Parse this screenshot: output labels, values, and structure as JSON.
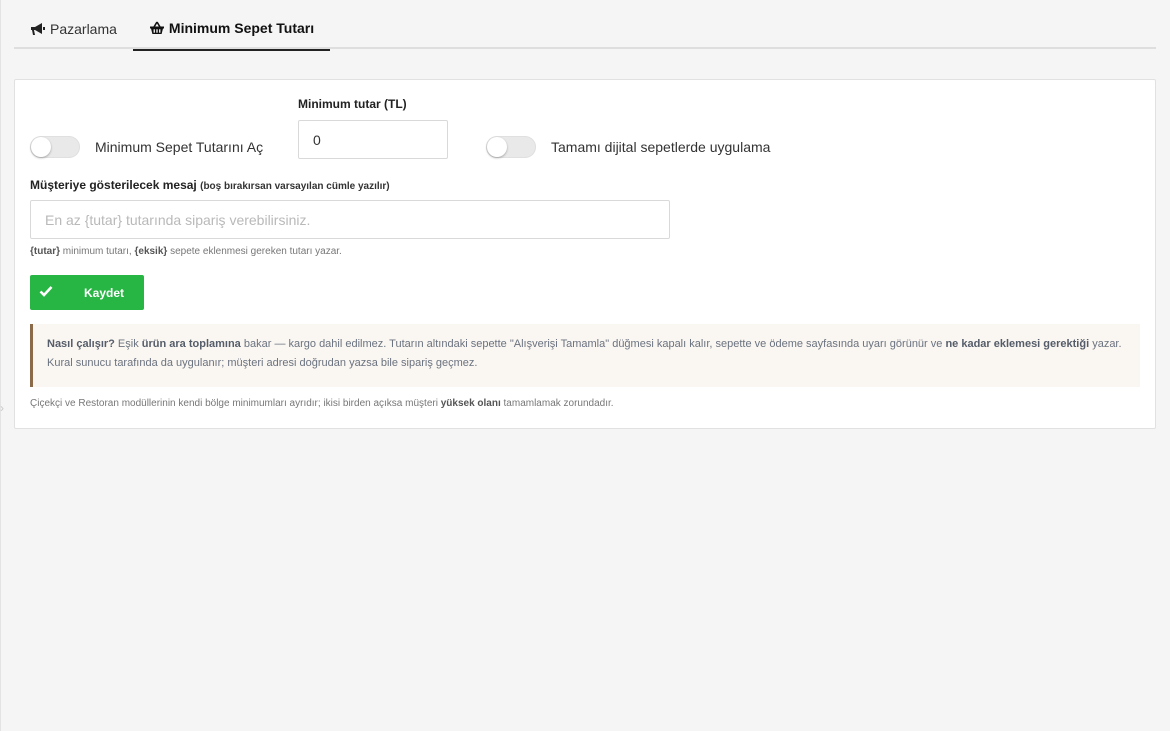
{
  "tabs": [
    {
      "label": "Pazarlama",
      "icon": "bullhorn-icon",
      "active": false
    },
    {
      "label": "Minimum Sepet Tutarı",
      "icon": "shopping-basket-icon",
      "active": true
    }
  ],
  "settings": {
    "enable_toggle": {
      "label": "Minimum Sepet Tutarını Aç",
      "on": false
    },
    "min_amount": {
      "label": "Minimum tutar (TL)",
      "value": "0"
    },
    "digital_toggle": {
      "label": "Tamamı dijital sepetlerde uygulama",
      "on": false
    },
    "message": {
      "label": "Müşteriye gösterilecek mesaj",
      "hint": "(boş bırakırsan varsayılan cümle yazılır)",
      "placeholder": "En az {tutar} tutarında sipariş verebilirsiniz.",
      "value": ""
    },
    "placeholders_note": {
      "tutar_token": "{tutar}",
      "tutar_text": " minimum tutarı, ",
      "eksik_token": "{eksik}",
      "eksik_text": " sepete eklenmesi gereken tutarı yazar."
    }
  },
  "save_button": {
    "label": "Kaydet",
    "icon": "check-icon"
  },
  "info": {
    "title": "Nasıl çalışır?",
    "part1": " Eşik ",
    "bold1": "ürün ara toplamına",
    "part2": " bakar — kargo dahil edilmez. Tutarın altındaki sepette \"Alışverişi Tamamla\" düğmesi kapalı kalır, sepette ve ödeme sayfasında uyarı görünür ve ",
    "bold2": "ne kadar eklemesi gerektiği",
    "part3": " yazar. Kural sunucu tarafında da uygulanır; müşteri adresi doğrudan yazsa bile sipariş geçmez."
  },
  "footer_note": {
    "part1": "Çiçekçi ve Restoran modüllerinin kendi bölge minimumları ayrıdır; ikisi birden açıksa müşteri ",
    "bold": "yüksek olanı",
    "part2": " tamamlamak zorundadır."
  },
  "colors": {
    "accent_green": "#27b544",
    "info_border": "#8b6a4a",
    "info_background": "#faf6f1"
  }
}
